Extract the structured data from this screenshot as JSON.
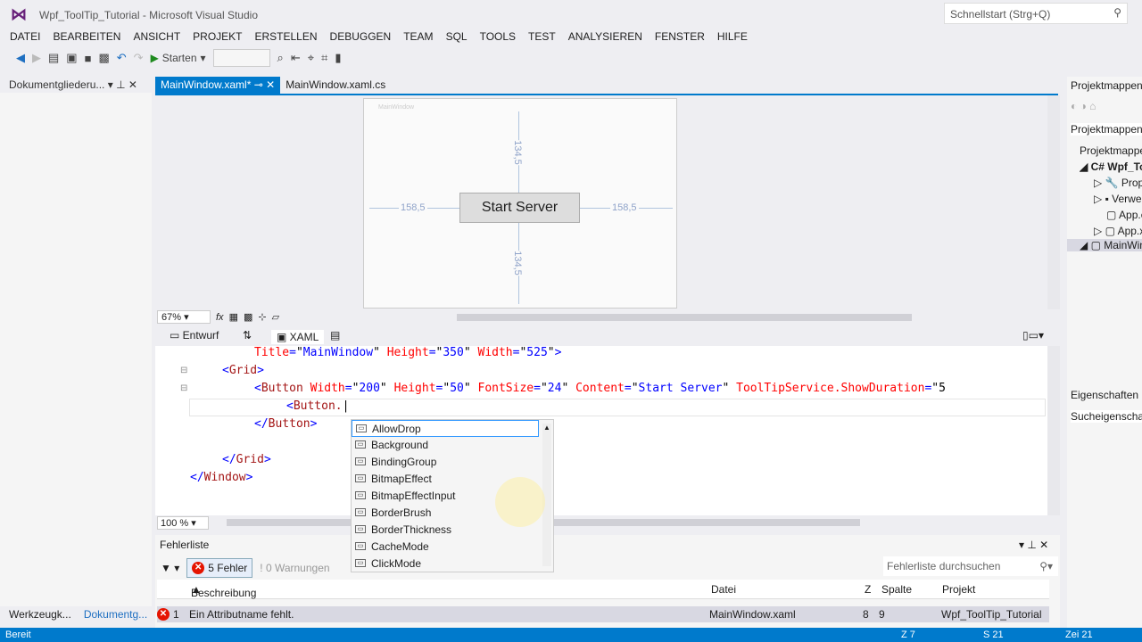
{
  "window": {
    "title": "Wpf_ToolTip_Tutorial - Microsoft Visual Studio",
    "quick_launch_placeholder": "Schnellstart (Strg+Q)"
  },
  "menu": [
    "DATEI",
    "BEARBEITEN",
    "ANSICHT",
    "PROJEKT",
    "ERSTELLEN",
    "DEBUGGEN",
    "TEAM",
    "SQL",
    "TOOLS",
    "TEST",
    "ANALYSIEREN",
    "FENSTER",
    "HILFE"
  ],
  "toolbar": {
    "start_label": "Starten"
  },
  "left_panel": {
    "title": "Dokumentgliederu...",
    "bottom_tabs": [
      "Werkzeugk...",
      "Dokumentg..."
    ]
  },
  "tabs": [
    {
      "label": "MainWindow.xaml*",
      "active": true
    },
    {
      "label": "MainWindow.xaml.cs",
      "active": false
    }
  ],
  "designer": {
    "window_caption": "MainWindow",
    "button_text": "Start Server",
    "margin_left": "158,5",
    "margin_right": "158,5",
    "margin_top": "134,5",
    "margin_bottom": "134,5",
    "zoom": "67%"
  },
  "split": {
    "design_tab": "Entwurf",
    "xaml_tab": "XAML"
  },
  "editor": {
    "zoom": "100 %"
  },
  "autocomplete": [
    "AllowDrop",
    "Background",
    "BindingGroup",
    "BitmapEffect",
    "BitmapEffectInput",
    "BorderBrush",
    "BorderThickness",
    "CacheMode",
    "ClickMode"
  ],
  "errors": {
    "title": "Fehlerliste",
    "errors_button": "5 Fehler",
    "warnings_button": "0 Warnungen",
    "search_placeholder": "Fehlerliste durchsuchen",
    "columns": [
      "Beschreibung",
      "Datei",
      "Z",
      "Spalte",
      "Projekt"
    ],
    "rows": [
      {
        "num": "1",
        "description": "Ein Attributname fehlt.",
        "file": "MainWindow.xaml",
        "line": "8",
        "column": "9",
        "project": "Wpf_ToolTip_Tutorial"
      }
    ]
  },
  "right_panel": {
    "title": "Projektmappen-Explorer",
    "search": "Projektmappen-Explorer durchsuchen",
    "tree": [
      "Projektmappe",
      "Wpf_ToolTip_Tutorial",
      "Properties",
      "Verweise",
      "App.config",
      "App.xaml",
      "MainWindow.xaml"
    ],
    "properties_title": "Eigenschaften",
    "properties_search": "Sucheigenschaften"
  },
  "status": {
    "left": "Bereit",
    "line": "Z 7",
    "col": "S 21",
    "char": "Zei 21"
  }
}
